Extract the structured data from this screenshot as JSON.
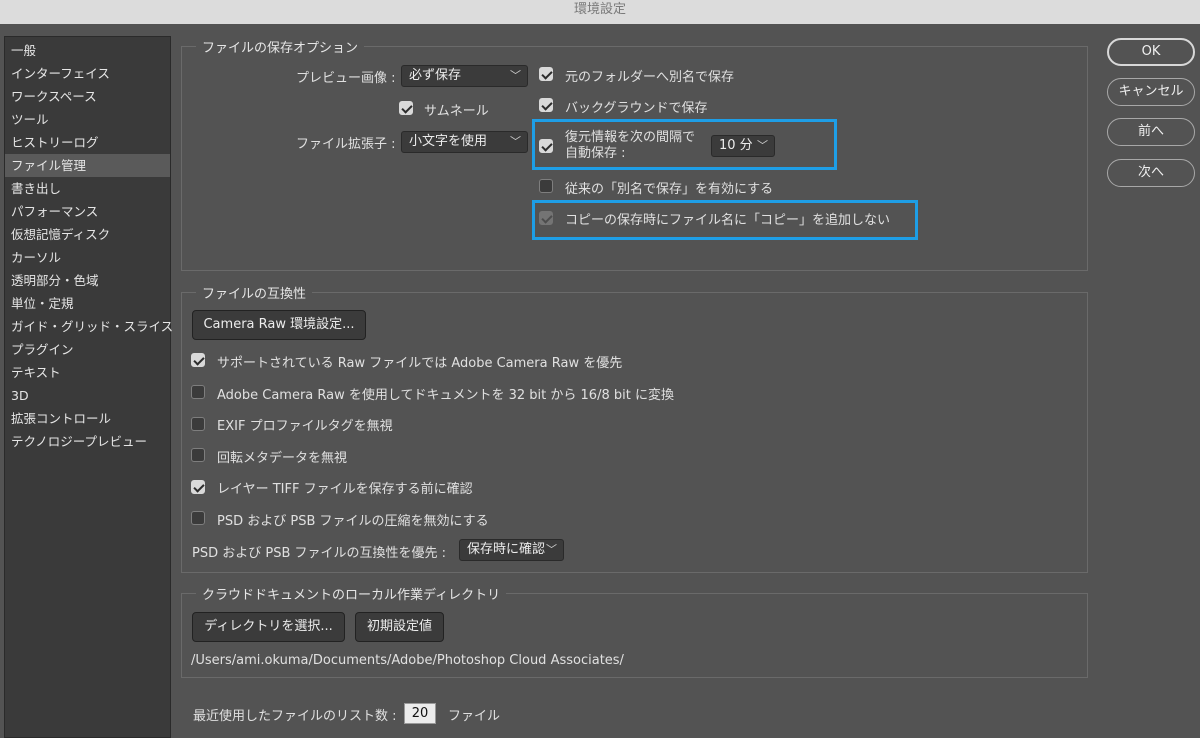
{
  "window": {
    "title": "環境設定"
  },
  "sidebar": {
    "items": [
      {
        "label": "一般"
      },
      {
        "label": "インターフェイス"
      },
      {
        "label": "ワークスペース"
      },
      {
        "label": "ツール"
      },
      {
        "label": "ヒストリーログ"
      },
      {
        "label": "ファイル管理",
        "selected": true
      },
      {
        "label": "書き出し"
      },
      {
        "label": "パフォーマンス"
      },
      {
        "label": "仮想記憶ディスク"
      },
      {
        "label": "カーソル"
      },
      {
        "label": "透明部分・色域"
      },
      {
        "label": "単位・定規"
      },
      {
        "label": "ガイド・グリッド・スライス"
      },
      {
        "label": "プラグイン"
      },
      {
        "label": "テキスト"
      },
      {
        "label": "3D"
      },
      {
        "label": "拡張コントロール"
      },
      {
        "label": "テクノロジープレビュー"
      }
    ]
  },
  "save_options": {
    "title": "ファイルの保存オプション",
    "preview_label": "プレビュー画像 :",
    "preview_value": "必ず保存",
    "thumbnail_label": "サムネール",
    "thumbnail_checked": true,
    "extension_label": "ファイル拡張子 :",
    "extension_value": "小文字を使用",
    "save_as_original_label": "元のフォルダーへ別名で保存",
    "save_as_original_checked": true,
    "background_save_label": "バックグラウンドで保存",
    "background_save_checked": true,
    "autosave_label_line1": "復元情報を次の間隔で",
    "autosave_label_line2": "自動保存 :",
    "autosave_checked": true,
    "autosave_interval": "10 分",
    "legacy_save_as_label": "従来の「別名で保存」を有効にする",
    "legacy_save_as_checked": false,
    "no_copy_suffix_label": "コピーの保存時にファイル名に「コピー」を追加しない",
    "no_copy_suffix_checked": true,
    "highlight_color": "#1e9ee6"
  },
  "compatibility": {
    "title": "ファイルの互換性",
    "camera_raw_button": "Camera Raw 環境設定...",
    "options": [
      {
        "label": "サポートされている Raw ファイルでは Adobe Camera Raw を優先",
        "checked": true
      },
      {
        "label": "Adobe Camera Raw を使用してドキュメントを 32 bit から 16/8 bit に変換",
        "checked": false
      },
      {
        "label": "EXIF プロファイルタグを無視",
        "checked": false
      },
      {
        "label": "回転メタデータを無視",
        "checked": false
      },
      {
        "label": "レイヤー TIFF ファイルを保存する前に確認",
        "checked": true
      },
      {
        "label": "PSD および PSB ファイルの圧縮を無効にする",
        "checked": false
      }
    ],
    "maximize_label": "PSD および PSB ファイルの互換性を優先 :",
    "maximize_value": "保存時に確認"
  },
  "cloud": {
    "title": "クラウドドキュメントのローカル作業ディレクトリ",
    "choose_button": "ディレクトリを選択...",
    "default_button": "初期設定値",
    "path": "/Users/ami.okuma/Documents/Adobe/Photoshop Cloud Associates/"
  },
  "recent": {
    "label": "最近使用したファイルのリスト数 :",
    "value": "20",
    "unit": "ファイル"
  },
  "actions": {
    "ok": "OK",
    "cancel": "キャンセル",
    "prev": "前へ",
    "next": "次へ"
  }
}
